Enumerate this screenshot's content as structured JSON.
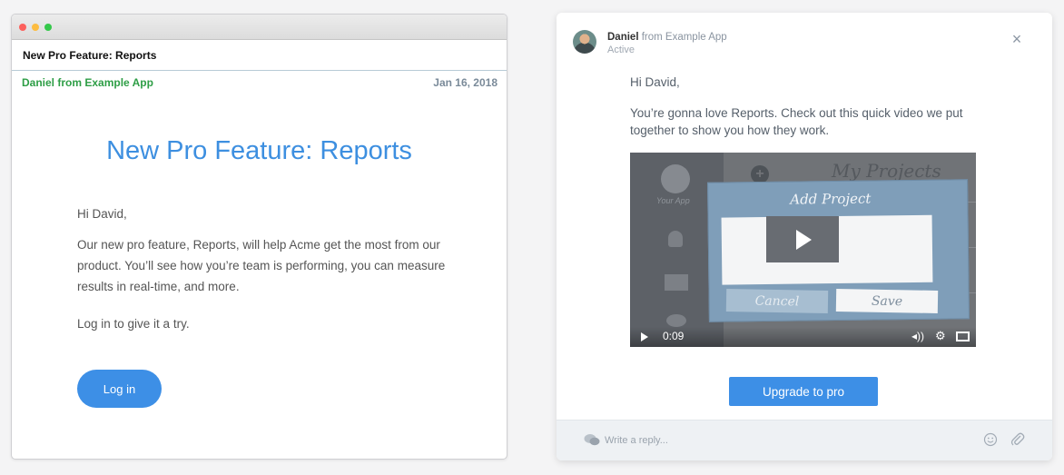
{
  "email": {
    "subject": "New Pro Feature: Reports",
    "sender": "Daniel from Example App",
    "date": "Jan 16, 2018",
    "headline": "New Pro Feature: Reports",
    "greeting": "Hi David,",
    "body": "Our new pro feature, Reports, will help Acme get the most from our product. You’ll see how you’re team is performing, you can measure results in real-time, and more.",
    "cta_text": "Log in to give it a try.",
    "login_label": "Log in",
    "colors": {
      "sender": "#2e9e46",
      "headline": "#3d8fe0",
      "button": "#3d8fe6"
    }
  },
  "chat": {
    "name": "Daniel",
    "from": "from Example App",
    "status": "Active",
    "close_label": "×",
    "greeting": "Hi David,",
    "message": "You’re gonna love Reports. Check out this quick video we put together to show you how they work.",
    "video": {
      "sidebar_app_label": "Your App",
      "heading": "My Projects",
      "modal_title": "Add Project",
      "cancel_label": "Cancel",
      "save_label": "Save",
      "time": "0:09",
      "icons": [
        "play-icon",
        "volume-icon",
        "settings-icon",
        "fullscreen-icon"
      ]
    },
    "upgrade_label": "Upgrade to pro",
    "reply_placeholder": "Write a reply...",
    "icons": [
      "chat-bubbles-icon",
      "emoji-icon",
      "attachment-icon",
      "close-icon"
    ],
    "colors": {
      "button": "#3d8fe6",
      "reply_bar": "#eef1f4"
    }
  }
}
